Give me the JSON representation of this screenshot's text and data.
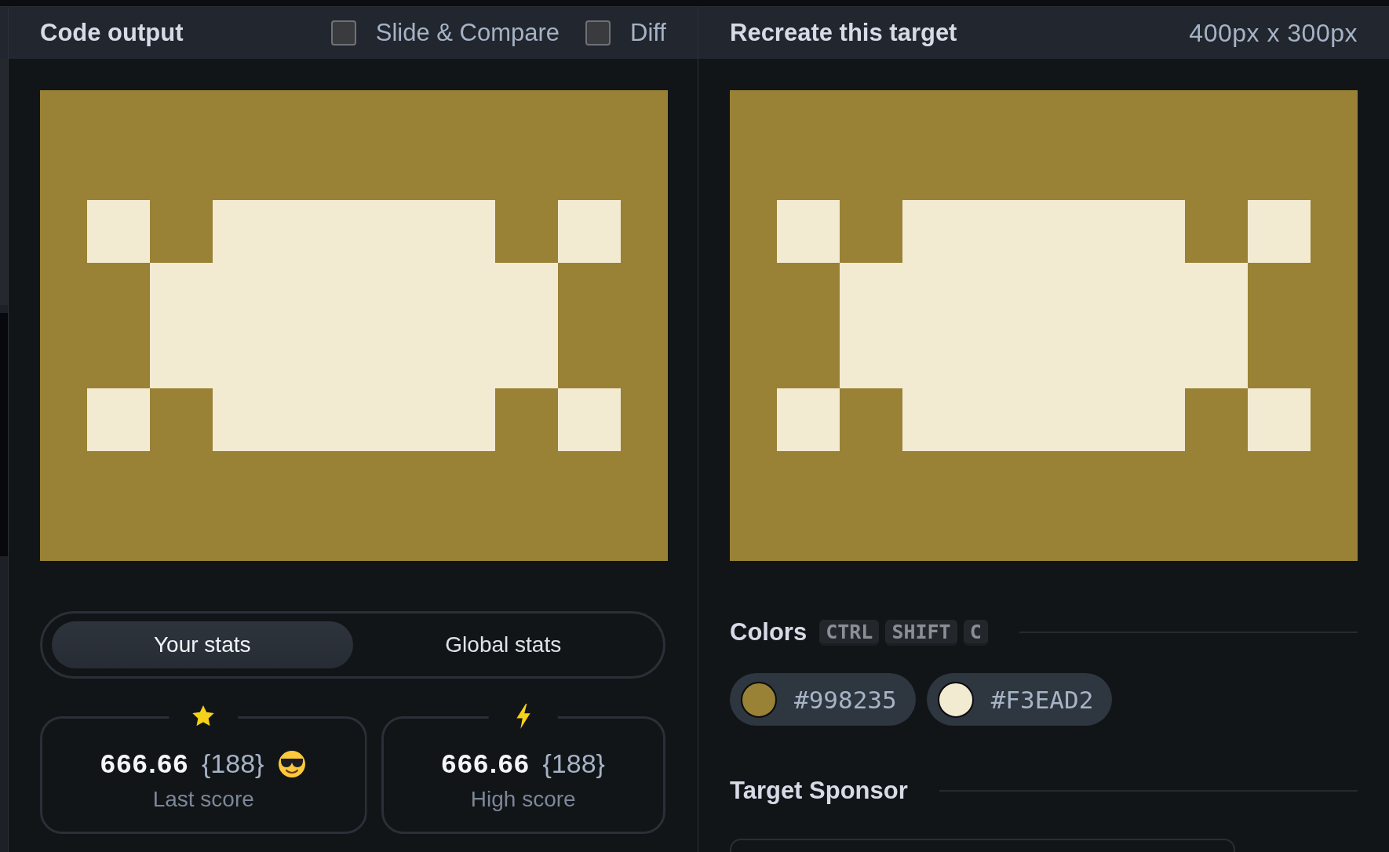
{
  "left_panel": {
    "title": "Code output",
    "options": [
      {
        "label": "Slide & Compare",
        "checked": false
      },
      {
        "label": "Diff",
        "checked": false
      }
    ]
  },
  "stats_tabs": [
    {
      "label": "Your stats",
      "selected": true
    },
    {
      "label": "Global stats",
      "selected": false
    }
  ],
  "score_cards": [
    {
      "kind": "last",
      "score": "666.66",
      "count": "{188}",
      "label": "Last score"
    },
    {
      "kind": "high",
      "score": "666.66",
      "count": "{188}",
      "label": "High score"
    }
  ],
  "right_panel": {
    "title": "Recreate this target",
    "size": "400px x 300px"
  },
  "colors": {
    "title": "Colors",
    "shortcut": [
      "CTRL",
      "SHIFT",
      "C"
    ],
    "swatches": [
      {
        "hex": "#998235",
        "color": "#998235"
      },
      {
        "hex": "#F3EAD2",
        "color": "#f3ead2"
      }
    ]
  },
  "sponsor": {
    "title": "Target Sponsor"
  }
}
